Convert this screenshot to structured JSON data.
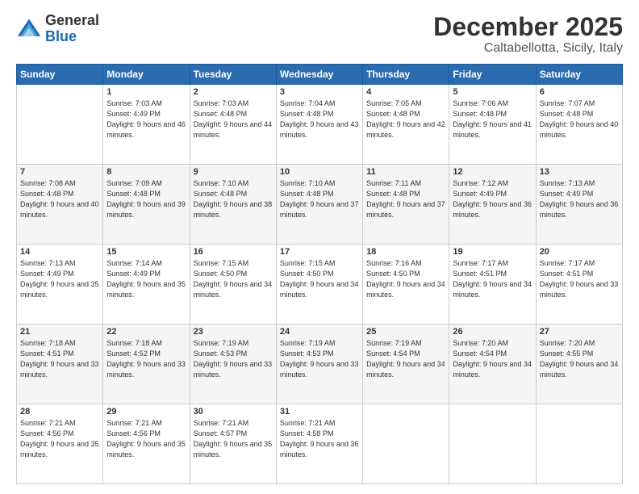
{
  "logo": {
    "general": "General",
    "blue": "Blue"
  },
  "title": "December 2025",
  "location": "Caltabellotta, Sicily, Italy",
  "headers": [
    "Sunday",
    "Monday",
    "Tuesday",
    "Wednesday",
    "Thursday",
    "Friday",
    "Saturday"
  ],
  "weeks": [
    [
      {
        "day": "",
        "sunrise": "",
        "sunset": "",
        "daylight": ""
      },
      {
        "day": "1",
        "sunrise": "Sunrise: 7:03 AM",
        "sunset": "Sunset: 4:49 PM",
        "daylight": "Daylight: 9 hours and 46 minutes."
      },
      {
        "day": "2",
        "sunrise": "Sunrise: 7:03 AM",
        "sunset": "Sunset: 4:48 PM",
        "daylight": "Daylight: 9 hours and 44 minutes."
      },
      {
        "day": "3",
        "sunrise": "Sunrise: 7:04 AM",
        "sunset": "Sunset: 4:48 PM",
        "daylight": "Daylight: 9 hours and 43 minutes."
      },
      {
        "day": "4",
        "sunrise": "Sunrise: 7:05 AM",
        "sunset": "Sunset: 4:48 PM",
        "daylight": "Daylight: 9 hours and 42 minutes."
      },
      {
        "day": "5",
        "sunrise": "Sunrise: 7:06 AM",
        "sunset": "Sunset: 4:48 PM",
        "daylight": "Daylight: 9 hours and 41 minutes."
      },
      {
        "day": "6",
        "sunrise": "Sunrise: 7:07 AM",
        "sunset": "Sunset: 4:48 PM",
        "daylight": "Daylight: 9 hours and 40 minutes."
      }
    ],
    [
      {
        "day": "7",
        "sunrise": "Sunrise: 7:08 AM",
        "sunset": "Sunset: 4:48 PM",
        "daylight": "Daylight: 9 hours and 40 minutes."
      },
      {
        "day": "8",
        "sunrise": "Sunrise: 7:09 AM",
        "sunset": "Sunset: 4:48 PM",
        "daylight": "Daylight: 9 hours and 39 minutes."
      },
      {
        "day": "9",
        "sunrise": "Sunrise: 7:10 AM",
        "sunset": "Sunset: 4:48 PM",
        "daylight": "Daylight: 9 hours and 38 minutes."
      },
      {
        "day": "10",
        "sunrise": "Sunrise: 7:10 AM",
        "sunset": "Sunset: 4:48 PM",
        "daylight": "Daylight: 9 hours and 37 minutes."
      },
      {
        "day": "11",
        "sunrise": "Sunrise: 7:11 AM",
        "sunset": "Sunset: 4:48 PM",
        "daylight": "Daylight: 9 hours and 37 minutes."
      },
      {
        "day": "12",
        "sunrise": "Sunrise: 7:12 AM",
        "sunset": "Sunset: 4:49 PM",
        "daylight": "Daylight: 9 hours and 36 minutes."
      },
      {
        "day": "13",
        "sunrise": "Sunrise: 7:13 AM",
        "sunset": "Sunset: 4:49 PM",
        "daylight": "Daylight: 9 hours and 36 minutes."
      }
    ],
    [
      {
        "day": "14",
        "sunrise": "Sunrise: 7:13 AM",
        "sunset": "Sunset: 4:49 PM",
        "daylight": "Daylight: 9 hours and 35 minutes."
      },
      {
        "day": "15",
        "sunrise": "Sunrise: 7:14 AM",
        "sunset": "Sunset: 4:49 PM",
        "daylight": "Daylight: 9 hours and 35 minutes."
      },
      {
        "day": "16",
        "sunrise": "Sunrise: 7:15 AM",
        "sunset": "Sunset: 4:50 PM",
        "daylight": "Daylight: 9 hours and 34 minutes."
      },
      {
        "day": "17",
        "sunrise": "Sunrise: 7:15 AM",
        "sunset": "Sunset: 4:50 PM",
        "daylight": "Daylight: 9 hours and 34 minutes."
      },
      {
        "day": "18",
        "sunrise": "Sunrise: 7:16 AM",
        "sunset": "Sunset: 4:50 PM",
        "daylight": "Daylight: 9 hours and 34 minutes."
      },
      {
        "day": "19",
        "sunrise": "Sunrise: 7:17 AM",
        "sunset": "Sunset: 4:51 PM",
        "daylight": "Daylight: 9 hours and 34 minutes."
      },
      {
        "day": "20",
        "sunrise": "Sunrise: 7:17 AM",
        "sunset": "Sunset: 4:51 PM",
        "daylight": "Daylight: 9 hours and 33 minutes."
      }
    ],
    [
      {
        "day": "21",
        "sunrise": "Sunrise: 7:18 AM",
        "sunset": "Sunset: 4:51 PM",
        "daylight": "Daylight: 9 hours and 33 minutes."
      },
      {
        "day": "22",
        "sunrise": "Sunrise: 7:18 AM",
        "sunset": "Sunset: 4:52 PM",
        "daylight": "Daylight: 9 hours and 33 minutes."
      },
      {
        "day": "23",
        "sunrise": "Sunrise: 7:19 AM",
        "sunset": "Sunset: 4:53 PM",
        "daylight": "Daylight: 9 hours and 33 minutes."
      },
      {
        "day": "24",
        "sunrise": "Sunrise: 7:19 AM",
        "sunset": "Sunset: 4:53 PM",
        "daylight": "Daylight: 9 hours and 33 minutes."
      },
      {
        "day": "25",
        "sunrise": "Sunrise: 7:19 AM",
        "sunset": "Sunset: 4:54 PM",
        "daylight": "Daylight: 9 hours and 34 minutes."
      },
      {
        "day": "26",
        "sunrise": "Sunrise: 7:20 AM",
        "sunset": "Sunset: 4:54 PM",
        "daylight": "Daylight: 9 hours and 34 minutes."
      },
      {
        "day": "27",
        "sunrise": "Sunrise: 7:20 AM",
        "sunset": "Sunset: 4:55 PM",
        "daylight": "Daylight: 9 hours and 34 minutes."
      }
    ],
    [
      {
        "day": "28",
        "sunrise": "Sunrise: 7:21 AM",
        "sunset": "Sunset: 4:56 PM",
        "daylight": "Daylight: 9 hours and 35 minutes."
      },
      {
        "day": "29",
        "sunrise": "Sunrise: 7:21 AM",
        "sunset": "Sunset: 4:56 PM",
        "daylight": "Daylight: 9 hours and 35 minutes."
      },
      {
        "day": "30",
        "sunrise": "Sunrise: 7:21 AM",
        "sunset": "Sunset: 4:57 PM",
        "daylight": "Daylight: 9 hours and 35 minutes."
      },
      {
        "day": "31",
        "sunrise": "Sunrise: 7:21 AM",
        "sunset": "Sunset: 4:58 PM",
        "daylight": "Daylight: 9 hours and 36 minutes."
      },
      {
        "day": "",
        "sunrise": "",
        "sunset": "",
        "daylight": ""
      },
      {
        "day": "",
        "sunrise": "",
        "sunset": "",
        "daylight": ""
      },
      {
        "day": "",
        "sunrise": "",
        "sunset": "",
        "daylight": ""
      }
    ]
  ]
}
